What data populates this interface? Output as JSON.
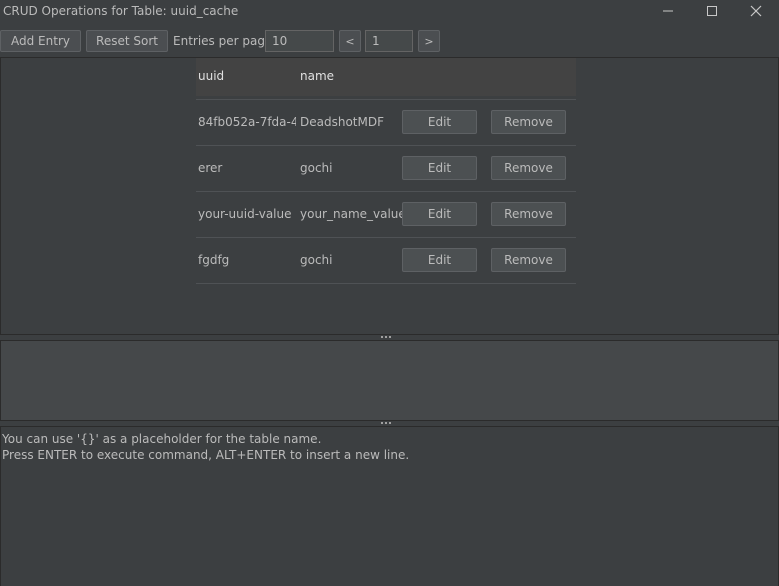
{
  "window": {
    "title": "CRUD Operations for Table: uuid_cache",
    "controls": {
      "minimize_icon": "minimize-icon",
      "maximize_icon": "maximize-icon",
      "close_icon": "close-icon"
    }
  },
  "toolbar": {
    "add_entry_label": "Add Entry",
    "reset_sort_label": "Reset Sort",
    "entries_per_page_label": "Entries per page:",
    "entries_per_page_value": "10",
    "prev_label": "<",
    "page_value": "1",
    "next_label": ">"
  },
  "table": {
    "columns": [
      "uuid",
      "name"
    ],
    "rows": [
      {
        "uuid": "84fb052a-7fda-4...",
        "name": "DeadshotMDF",
        "edit": "Edit",
        "remove": "Remove"
      },
      {
        "uuid": "erer",
        "name": "gochi",
        "edit": "Edit",
        "remove": "Remove"
      },
      {
        "uuid": "your-uuid-value",
        "name": "your_name_value",
        "edit": "Edit",
        "remove": "Remove"
      },
      {
        "uuid": "fgdfg",
        "name": "gochi",
        "edit": "Edit",
        "remove": "Remove"
      }
    ]
  },
  "console": {
    "help_line_1": "You can use '{}' as a placeholder for the table name.",
    "help_line_2": "Press ENTER to execute command, ALT+ENTER to insert a new line."
  },
  "colors": {
    "background": "#3c3f41",
    "text": "#bbbbbb",
    "header_bg": "#434343",
    "button_bg": "#4c5052"
  }
}
